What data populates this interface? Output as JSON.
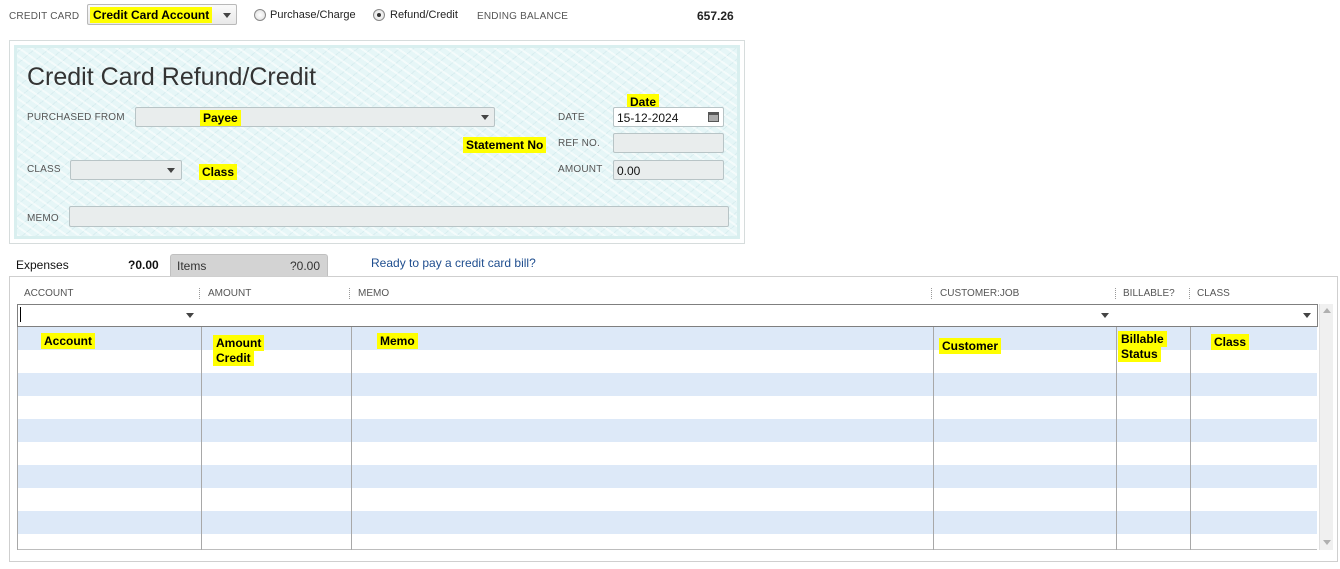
{
  "topbar": {
    "credit_card_label": "CREDIT CARD",
    "credit_card_value": "Credit Card Account",
    "option_purchase": "Purchase/Charge",
    "option_refund": "Refund/Credit",
    "selected_option": "Refund/Credit",
    "ending_balance_label": "ENDING BALANCE",
    "ending_balance_value": "657.26"
  },
  "form": {
    "title": "Credit Card Refund/Credit",
    "purchased_from_label": "PURCHASED FROM",
    "payee_value": "Payee",
    "class_label": "CLASS",
    "class_value": "Class",
    "memo_label": "MEMO",
    "memo_value": "",
    "date_label": "DATE",
    "date_annotation": "Date",
    "date_value": "15-12-2024",
    "ref_label": "REF NO.",
    "ref_annotation": "Statement No",
    "ref_value": "",
    "amount_label": "AMOUNT",
    "amount_value": "0.00"
  },
  "tabs": {
    "expenses_label": "Expenses",
    "expenses_amount": "?0.00",
    "items_label": "Items",
    "items_amount": "?0.00",
    "pay_bill_link": "Ready to pay a credit card bill?"
  },
  "grid": {
    "headers": {
      "account": "ACCOUNT",
      "amount": "AMOUNT",
      "memo": "MEMO",
      "customer_job": "CUSTOMER:JOB",
      "billable": "BILLABLE?",
      "class": "CLASS"
    },
    "annotations": {
      "account": "Account",
      "amount_line1": "Amount",
      "amount_line2": "Credit",
      "memo": "Memo",
      "customer": "Customer",
      "billable_line1": "Billable",
      "billable_line2": "Status",
      "class": "Class"
    }
  },
  "colors": {
    "highlight": "#ffff00",
    "form_background": "#e6f6f7",
    "row_band": "#dde9f8",
    "link": "#1f4e8f"
  }
}
